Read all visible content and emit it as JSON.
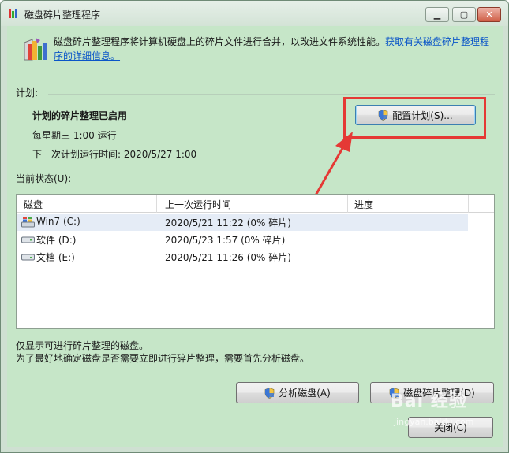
{
  "window": {
    "title": "磁盘碎片整理程序",
    "controls": {
      "minimize": "▁",
      "maximize": "▢",
      "close": "✕"
    }
  },
  "intro": {
    "text": "磁盘碎片整理程序将计算机硬盘上的碎片文件进行合并，以改进文件系统性能。",
    "link": "获取有关磁盘碎片整理程序的详细信息。"
  },
  "schedule": {
    "label": "计划:",
    "status": "计划的碎片整理已启用",
    "frequency": "每星期三  1:00 运行",
    "next_run": "下一次计划运行时间: 2020/5/27 1:00",
    "configure_button": "配置计划(S)..."
  },
  "current_status": {
    "label": "当前状态(U):",
    "columns": [
      "磁盘",
      "上一次运行时间",
      "进度"
    ],
    "rows": [
      {
        "disk": "Win7 (C:)",
        "last_run": "2020/5/21 11:22 (0% 碎片)",
        "progress": "",
        "icon": "windows-drive-icon"
      },
      {
        "disk": "软件 (D:)",
        "last_run": "2020/5/23 1:57 (0% 碎片)",
        "progress": "",
        "icon": "drive-icon"
      },
      {
        "disk": "文档 (E:)",
        "last_run": "2020/5/21 11:26 (0% 碎片)",
        "progress": "",
        "icon": "drive-icon"
      }
    ]
  },
  "notes": {
    "line1": "仅显示可进行碎片整理的磁盘。",
    "line2": "为了最好地确定磁盘是否需要立即进行碎片整理，需要首先分析磁盘。"
  },
  "buttons": {
    "analyze": "分析磁盘(A)",
    "defragment": "磁盘碎片整理(D)",
    "close": "关闭(C)"
  },
  "watermark": {
    "brand": "Bai 经验",
    "site": "jingyan.baidu.com"
  },
  "colors": {
    "window_bg": "#c6e6c8",
    "link": "#0a55c8",
    "highlight_box": "#e53935",
    "annotation_arrow": "#e53935"
  }
}
